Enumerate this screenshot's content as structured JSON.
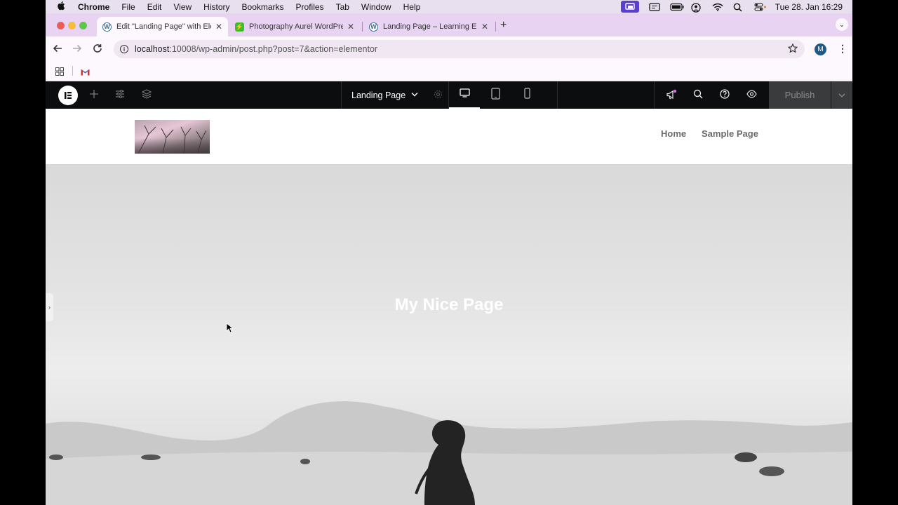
{
  "menubar": {
    "app": "Chrome",
    "items": [
      "File",
      "Edit",
      "View",
      "History",
      "Bookmarks",
      "Profiles",
      "Tab",
      "Window",
      "Help"
    ],
    "clock": "Tue 28. Jan  16:29"
  },
  "tabs": [
    {
      "title": "Edit \"Landing Page\" with Elementor",
      "favicon": "wordpress-icon"
    },
    {
      "title": "Photography Aurel WordPress",
      "favicon": "elementor-leaf-icon"
    },
    {
      "title": "Landing Page – Learning Elementor",
      "favicon": "wordpress-icon"
    }
  ],
  "address": {
    "host": "localhost",
    "path": ":10008/wp-admin/post.php?post=7&action=elementor"
  },
  "profile": {
    "initial": "M"
  },
  "elementor": {
    "document_title": "Landing Page",
    "publish_label": "Publish"
  },
  "site": {
    "nav": [
      "Home",
      "Sample Page"
    ],
    "hero_title": "My Nice Page"
  },
  "colors": {
    "menubar_bg": "#e9e0ef",
    "tabbar_bg": "#e9d3f2",
    "elementor_bar": "#0c0d0e",
    "publish_bg": "#3a3b3c",
    "notification_dot": "#d96bd8"
  }
}
